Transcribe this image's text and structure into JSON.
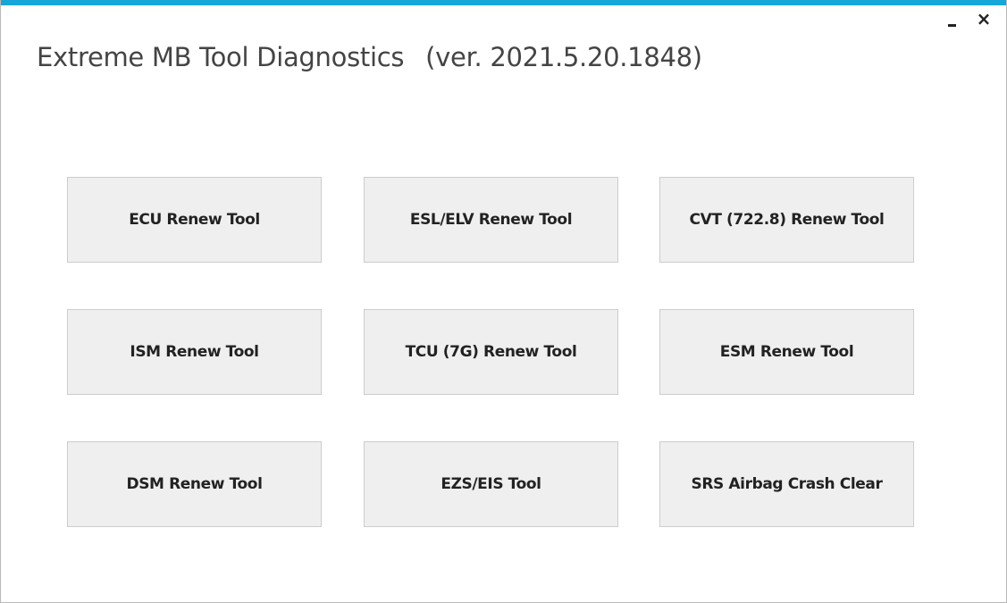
{
  "window": {
    "title": "Extreme MB Tool Diagnostics",
    "version": "(ver. 2021.5.20.1848)",
    "minimize_label": "-",
    "close_label": "×",
    "accent_color": "#16a7d8"
  },
  "tools": [
    {
      "label": "ECU Renew Tool"
    },
    {
      "label": "ESL/ELV Renew Tool"
    },
    {
      "label": "CVT (722.8) Renew Tool"
    },
    {
      "label": "ISM Renew Tool"
    },
    {
      "label": "TCU (7G) Renew Tool"
    },
    {
      "label": "ESM Renew Tool"
    },
    {
      "label": "DSM Renew Tool"
    },
    {
      "label": "EZS/EIS Tool"
    },
    {
      "label": "SRS Airbag Crash Clear"
    }
  ]
}
